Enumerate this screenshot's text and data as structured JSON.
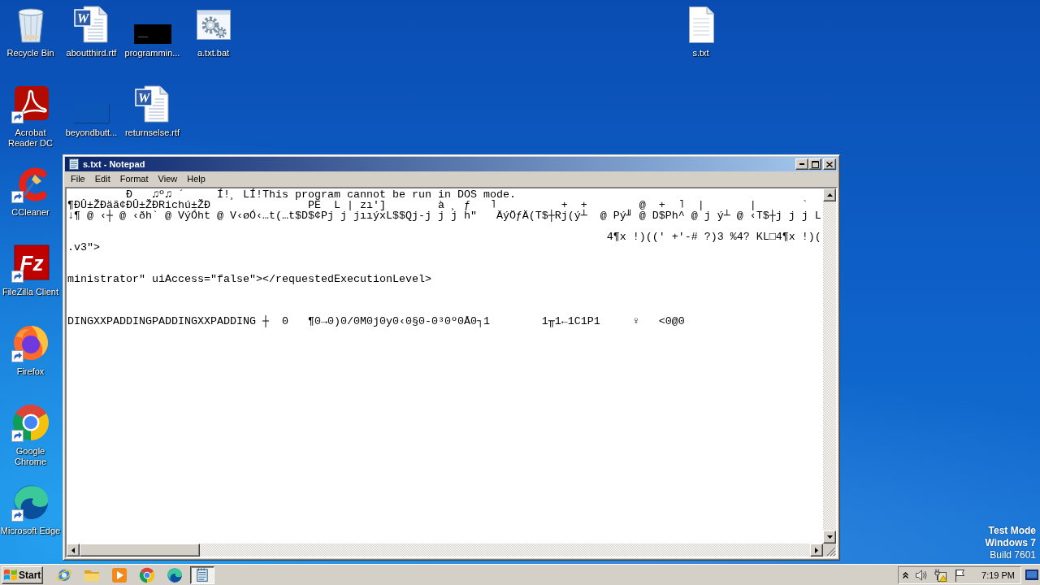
{
  "desktop": {
    "icons": [
      {
        "label": "Recycle Bin",
        "kind": "bin",
        "shortcut": false
      },
      {
        "label": "aboutthird.rtf",
        "kind": "word",
        "logo": "W",
        "shortcut": false
      },
      {
        "label": "programmin...",
        "kind": "console",
        "shortcut": false
      },
      {
        "label": "a.txt.bat",
        "kind": "batch",
        "shortcut": false
      },
      {
        "label": "s.txt",
        "kind": "text",
        "shortcut": false
      },
      {
        "label": "Acrobat Reader DC",
        "kind": "acrobat",
        "shortcut": true
      },
      {
        "label": "beyondbutt...",
        "kind": "blank",
        "shortcut": false
      },
      {
        "label": "returnselse.rtf",
        "kind": "word",
        "logo": "W",
        "shortcut": false
      },
      {
        "label": "CCleaner",
        "kind": "ccleaner",
        "shortcut": true
      },
      {
        "label": "FileZilla Client",
        "kind": "filezilla",
        "logo": "Fz",
        "shortcut": true
      },
      {
        "label": "Firefox",
        "kind": "firefox",
        "shortcut": true
      },
      {
        "label": "Google Chrome",
        "kind": "chrome",
        "shortcut": true
      },
      {
        "label": "Microsoft Edge",
        "kind": "edge",
        "shortcut": true
      }
    ]
  },
  "notepad": {
    "title": "s.txt - Notepad",
    "menu": [
      "File",
      "Edit",
      "Format",
      "View",
      "Help"
    ],
    "text": "         Ð   ♫º♫ ´     Í!¸ LÍ!This program cannot be run in DOS mode.\n¶ÐÛ±ŽÐäã¢ÐÛ±ŽÐRichú±ŽÐ               PE  L | zı']        à ¸ ƒ   ˥          +  +        @  +  ˥  |       |       `\n↓¶ @ ‹┼ @ ‹ðh` @ VýÓht @ V‹øÓ‹…t(…t$D$¢Pj j jııýxL$$Qj-j j j h\"   ÄýÖƒÄ(T$┼Rj(ý┴  @ Pý╜ @ D$Ph^ @ j ý┴ @ ‹T$┼j j j L\n\n                                                                                   4¶x !)((' +'-# ?)3 %4? KL□4¶x !)(\n.v3\">\n\n\nministrator\" uiAccess=\"false\"></requestedExecutionLevel>\n\n\n\nDINGXXPADDINGPADDINGXXPADDING ┼  0   ¶0→0)0/0M0j0y0‹0§0-0³0º0Å0┐1        1╥1←1C1P1     ♀   <0@0"
  },
  "notice": {
    "mode": "Test Mode",
    "os": "Windows 7",
    "build": "Build 7601"
  },
  "taskbar": {
    "start": "Start",
    "tasks": [
      {
        "kind": "notepad",
        "selected": true
      }
    ],
    "clock": "7:19 PM"
  }
}
